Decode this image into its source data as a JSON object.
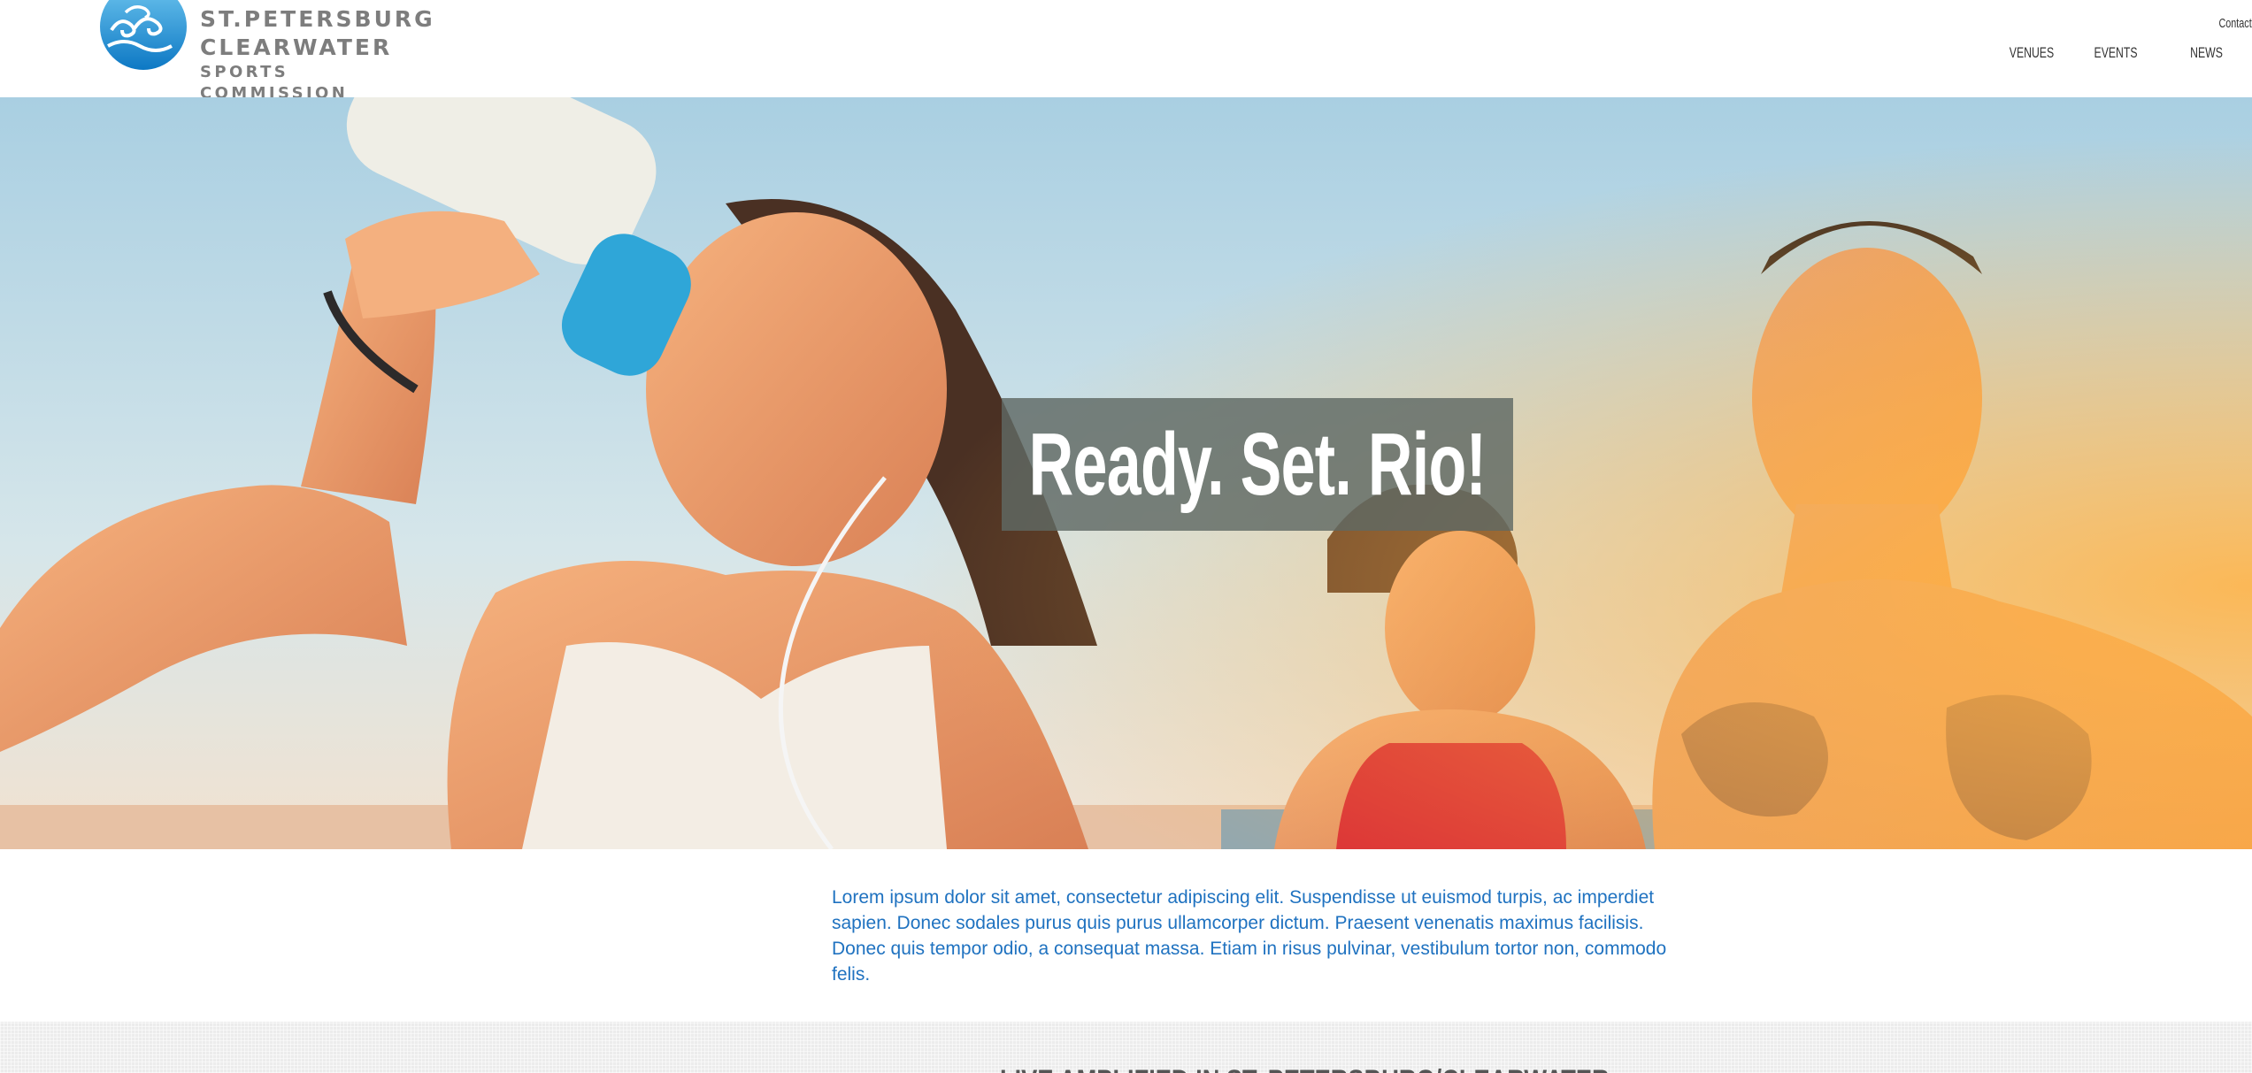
{
  "header": {
    "logo": {
      "line1": "ST.PETERSBURG",
      "line2": "CLEARWATER",
      "line3": "SPORTS COMMISSION",
      "brand_color": "#1a8fd6"
    },
    "contact_label": "Contact",
    "nav": [
      {
        "label": "VENUES"
      },
      {
        "label": "EVENTS"
      },
      {
        "label": "NEWS"
      }
    ]
  },
  "hero": {
    "title": "Ready. Set. Rio!",
    "image": "athletes-drinking-water-beach-photo"
  },
  "intro": {
    "text": "Lorem ipsum dolor sit amet, consectetur adipiscing elit. Suspendisse ut euismod turpis, ac imperdiet sapien. Donec sodales purus quis purus ullamcorper dictum. Praesent venenatis maximus facilisis. Donec quis tempor odio, a consequat massa. Etiam in risus pulvinar, vestibulum tortor non, commodo felis.",
    "text_color": "#1f72c0"
  },
  "band": {
    "heading": "LIVE AMPLIFIED IN ST. PETERSBURG/CLEARWATER"
  }
}
